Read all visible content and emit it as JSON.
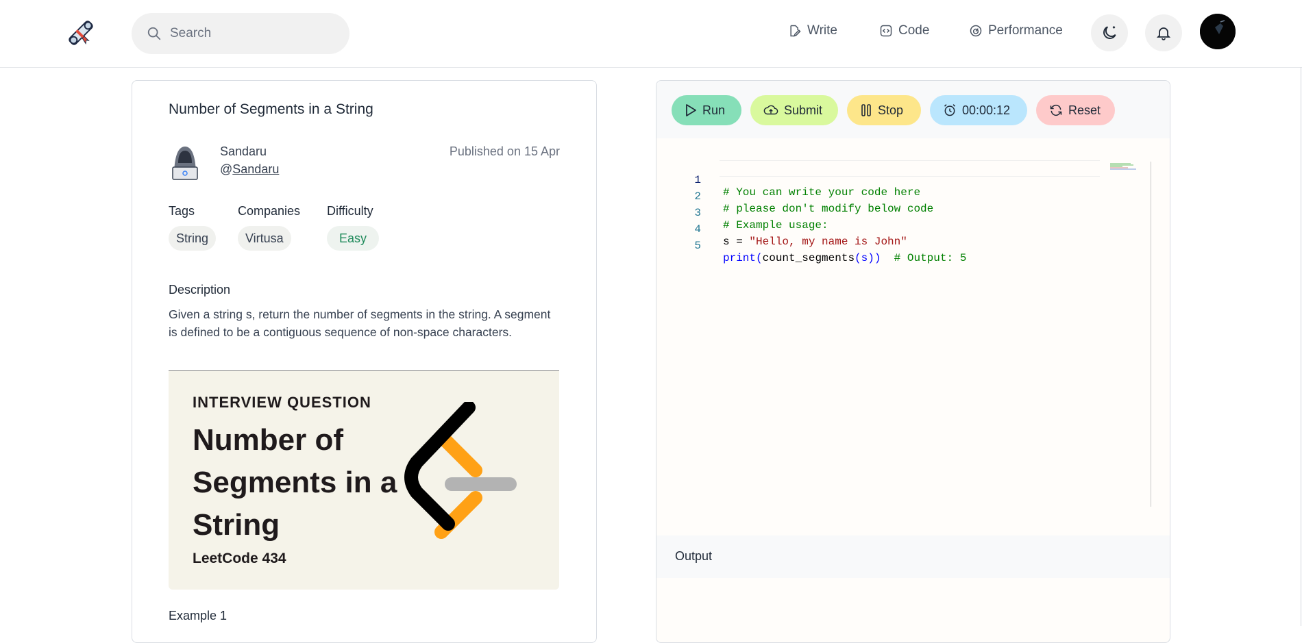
{
  "header": {
    "search_placeholder": "Search",
    "nav": [
      {
        "label": "Write",
        "icon": "edit-icon"
      },
      {
        "label": "Code",
        "icon": "code-icon"
      },
      {
        "label": "Performance",
        "icon": "gauge-icon"
      }
    ]
  },
  "problem": {
    "title": "Number of Segments in a String",
    "author_name": "Sandaru",
    "author_handle_prefix": "@",
    "author_handle": "Sandaru",
    "published": "Published on 15 Apr",
    "tags_label": "Tags",
    "companies_label": "Companies",
    "difficulty_label": "Difficulty",
    "tag": "String",
    "company": "Virtusa",
    "difficulty": "Easy",
    "description_label": "Description",
    "description": "Given a string s, return the number of segments in the string. A segment is defined to be a contiguous sequence of non-space characters.",
    "banner": {
      "kicker": "INTERVIEW QUESTION",
      "title": "Number of Segments in a String",
      "subtitle": "LeetCode 434"
    },
    "example_label": "Example 1"
  },
  "editor": {
    "toolbar": {
      "run": "Run",
      "submit": "Submit",
      "stop": "Stop",
      "timer": "00:00:12",
      "reset": "Reset"
    },
    "lines": [
      {
        "n": "1",
        "text": "# You can write your code here"
      },
      {
        "n": "2",
        "text": "# please don't modify below code"
      },
      {
        "n": "3",
        "text": "# Example usage:"
      },
      {
        "n": "4",
        "text": "s = \"Hello, my name is John\""
      },
      {
        "n": "5",
        "text": "print(count_segments(s))  # Output: 5"
      }
    ],
    "code_tokens": {
      "l4_a": "s = ",
      "l4_b": "\"Hello, my name is John\"",
      "l5_a": "print",
      "l5_b": "(",
      "l5_c": "count_segments",
      "l5_d": "(s)",
      "l5_e": ")",
      "l5_f": "  # Output: 5"
    },
    "output_label": "Output"
  },
  "colors": {
    "run": "#86dfb8",
    "submit": "#d9f99d",
    "stop": "#fde68a",
    "timer": "#bae6fd",
    "reset": "#fecaca",
    "easy": "#1f8a5b"
  }
}
